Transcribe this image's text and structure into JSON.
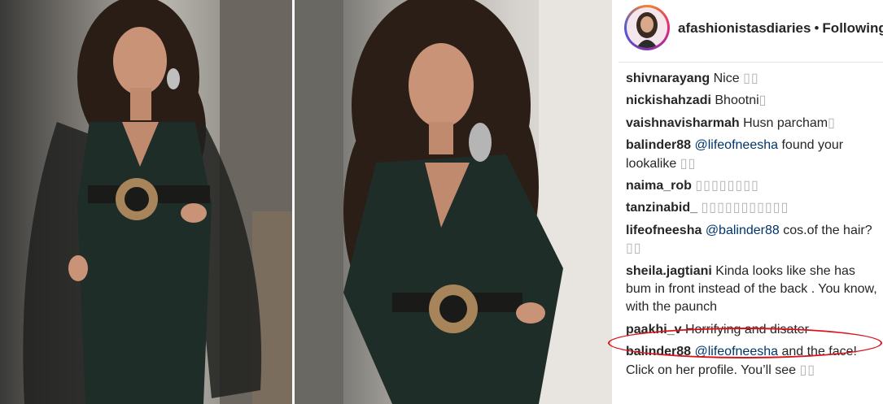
{
  "header": {
    "username": "afashionistasdiaries",
    "separator": "•",
    "follow_label": "Following"
  },
  "comments": [
    {
      "user": "shivnarayang",
      "text": "Nice",
      "emoji": "▯▯"
    },
    {
      "user": "nickishahzadi",
      "text": "Bhootni",
      "emoji": "▯"
    },
    {
      "user": "vaishnavisharmah",
      "text": "Husn parcham",
      "emoji": "▯"
    },
    {
      "user": "balinder88",
      "mention": "@lifeofneesha",
      "text": "found your lookalike",
      "emoji": "▯▯"
    },
    {
      "user": "naima_rob",
      "text": "",
      "emoji": "▯▯▯▯▯▯▯▯"
    },
    {
      "user": "tanzinabid_",
      "text": "",
      "emoji": "▯▯▯▯▯▯▯▯▯▯▯"
    },
    {
      "user": "lifeofneesha",
      "mention": "@balinder88",
      "text": "cos.of the hair?",
      "emoji": "▯▯"
    },
    {
      "user": "sheila.jagtiani",
      "text": "Kinda looks like she has bum in front instead of the back . You know, with the paunch",
      "emoji": ""
    },
    {
      "user": "paakhi_v",
      "text": "Horrifying and disater",
      "emoji": ""
    },
    {
      "user": "balinder88",
      "mention": "@lifeofneesha",
      "text": "and the face! Click on her profile. You’ll see",
      "emoji": "▯▯"
    }
  ],
  "colors": {
    "highlight_ellipse": "#d8141c",
    "outfit": "#1f2d28",
    "mention": "#003569"
  }
}
